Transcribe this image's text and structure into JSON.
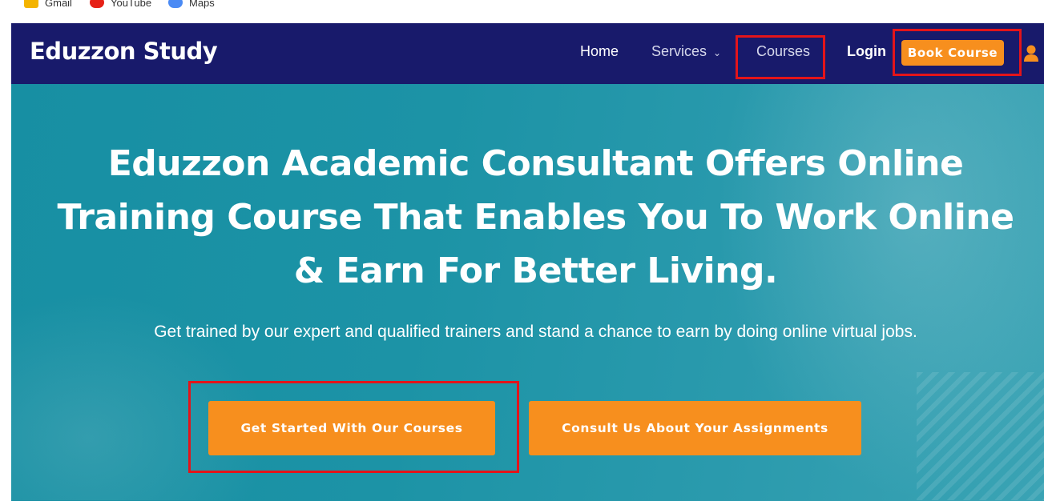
{
  "bookmarks": [
    {
      "label": "Gmail",
      "color": "#f4b400"
    },
    {
      "label": "YouTube",
      "color": "#e62117"
    },
    {
      "label": "Maps",
      "color": "#4a8af4"
    }
  ],
  "header": {
    "brand": "Eduzzon Study",
    "nav": {
      "home": "Home",
      "services": "Services",
      "courses": "Courses",
      "login": "Login"
    },
    "book_button": "Book Course",
    "user_icon": "user-icon"
  },
  "hero": {
    "title": "Eduzzon Academic Consultant Offers Online Training Course That Enables You To Work Online & Earn For Better Living.",
    "subtitle": "Get trained by our expert and qualified trainers and stand a chance to earn by doing online virtual jobs.",
    "primary_cta": "Get Started With Our Courses",
    "secondary_cta": "Consult Us About Your Assignments"
  },
  "colors": {
    "header_bg": "#181a6b",
    "accent": "#f78f1e",
    "hero_bg": "#1c93a6",
    "highlight": "#e3141a"
  }
}
